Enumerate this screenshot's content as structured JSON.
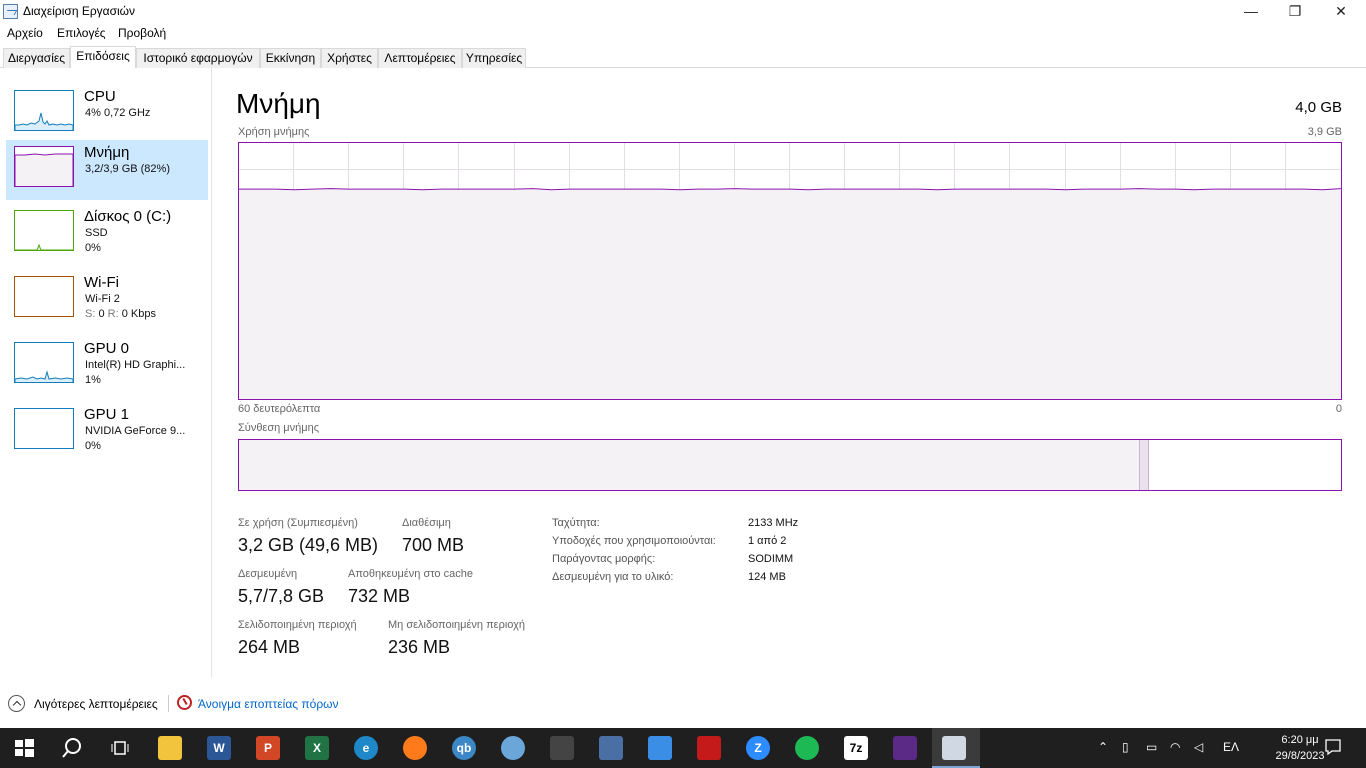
{
  "window": {
    "title": "Διαχείριση Εργασιών",
    "minimize": "—",
    "maximize": "❐",
    "close": "✕"
  },
  "menu": [
    "Αρχείο",
    "Επιλογές",
    "Προβολή"
  ],
  "tabs": [
    "Διεργασίες",
    "Επιδόσεις",
    "Ιστορικό εφαρμογών",
    "Εκκίνηση",
    "Χρήστες",
    "Λεπτομέρειες",
    "Υπηρεσίες"
  ],
  "active_tab": "Επιδόσεις",
  "sidebar": {
    "items": [
      {
        "title": "CPU",
        "line1": "4% 0,72 GHz",
        "line2": "",
        "color": "#117dbb"
      },
      {
        "title": "Μνήμη",
        "line1": "3,2/3,9 GB (82%)",
        "line2": "",
        "color": "#8b12ae"
      },
      {
        "title": "Δίσκος 0 (C:)",
        "line1": "SSD",
        "line2": "0%",
        "color": "#4da60c"
      },
      {
        "title": "Wi-Fi",
        "line1": "Wi-Fi 2",
        "line2_s_label": "S:",
        "line2_s_val": "0",
        "line2_r_label": "R:",
        "line2_r_val": "0 Kbps",
        "color": "#a74f01"
      },
      {
        "title": "GPU 0",
        "line1": "Intel(R) HD Graphi...",
        "line2": "1%",
        "color": "#117dbb"
      },
      {
        "title": "GPU 1",
        "line1": "NVIDIA GeForce 9...",
        "line2": "0%",
        "color": "#117dbb"
      }
    ]
  },
  "memory": {
    "title": "Μνήμη",
    "total": "4,0 GB",
    "usage_label": "Χρήση μνήμης",
    "usage_max": "3,9 GB",
    "time_label": "60 δευτερόλεπτα",
    "time_end": "0",
    "composition_label": "Σύνθεση μνήμης",
    "usage_level_fraction": 0.82,
    "composition": {
      "in_use_fraction": 0.817,
      "modified_fraction": 0.009
    },
    "accent_color": "#8b12ae"
  },
  "stats": {
    "in_use_label": "Σε χρήση (Συμπιεσμένη)",
    "in_use_value": "3,2 GB (49,6 MB)",
    "available_label": "Διαθέσιμη",
    "available_value": "700 MB",
    "committed_label": "Δεσμευμένη",
    "committed_value": "5,7/7,8 GB",
    "cached_label": "Αποθηκευμένη στο cache",
    "cached_value": "732 MB",
    "paged_label": "Σελιδοποιημένη περιοχή",
    "paged_value": "264 MB",
    "nonpaged_label": "Μη σελιδοποιημένη περιοχή",
    "nonpaged_value": "236 MB"
  },
  "info": {
    "speed_label": "Ταχύτητα:",
    "speed_value": "2133 MHz",
    "slots_label": "Υποδοχές που χρησιμοποιούνται:",
    "slots_value": "1 από 2",
    "form_label": "Παράγοντας μορφής:",
    "form_value": "SODIMM",
    "reserved_label": "Δεσμευμένη για το υλικό:",
    "reserved_value": "124 MB"
  },
  "footer": {
    "less_details": "Λιγότερες λεπτομέρειες",
    "resource_monitor": "Άνοιγμα εποπτείας πόρων"
  },
  "taskbar": {
    "icons": [
      "start",
      "search",
      "task-view",
      "file-explorer",
      "word",
      "powerpoint",
      "excel",
      "edge",
      "firefox",
      "qbittorrent",
      "paint",
      "inkscape",
      "calculator",
      "control-panel",
      "acrobat",
      "zoom",
      "spotify",
      "7zip",
      "cpu-z",
      "task-manager"
    ],
    "tray_language": "ΕΛ",
    "time": "6:20 μμ",
    "date": "29/8/2023"
  }
}
